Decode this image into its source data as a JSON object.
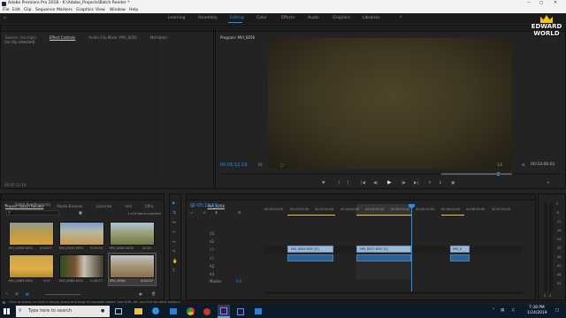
{
  "title": "Adobe Premiere Pro 2018 - K:\\Adobe_Projects\\Batch Render *",
  "menu": [
    "File",
    "Edit",
    "Clip",
    "Sequence",
    "Markers",
    "Graphics",
    "View",
    "Window",
    "Help"
  ],
  "workspaces": [
    "Learning",
    "Assembly",
    "Editing",
    "Color",
    "Effects",
    "Audio",
    "Graphics",
    "Libraries"
  ],
  "active_workspace": "Editing",
  "brand": {
    "line1": "EDWARD",
    "line2": "WORLD"
  },
  "source_panel": {
    "tabs": [
      "Source: (no clips)",
      "Effect Controls",
      "Audio Clip Mixer: MVI_6056",
      "Metadata"
    ],
    "active_tab": "Effect Controls",
    "body_text": "(no clip selected)",
    "footer_time": "00:05:12:19"
  },
  "program": {
    "tab": "Program: MVI_6056",
    "timecode": "00:05:12:19",
    "fit": "Fit",
    "quality": "1/2",
    "duration": "00:10:06:01"
  },
  "project": {
    "tabs": [
      "Project: Batch Render",
      "Media Browser",
      "Libraries",
      "Info",
      "Effec"
    ],
    "active_tab": "Project: Batch Render",
    "file": "Batch Render.prproj",
    "count": "1 of 6 items selected",
    "thumbs": [
      {
        "name": "MVI_6056.MOV",
        "dur": "4:04:01"
      },
      {
        "name": "MVI_6055.MOV",
        "dur": "5:01:00"
      },
      {
        "name": "MVI_6060.MOV",
        "dur": "10:01"
      },
      {
        "name": "MVI_6063.MOV",
        "dur": "4:07"
      },
      {
        "name": "MVI_6065.MOV",
        "dur": "2:28:27"
      },
      {
        "name": "MVI_6056",
        "dur": "4:02:07"
      }
    ]
  },
  "timeline": {
    "tab": "MVI_6056",
    "timecode": "00:05:12:19",
    "ruler": [
      "00:02:30:00",
      "00:03:00:00",
      "00:03:30:00",
      "00:04:00:00",
      "00:04:30:00",
      "00:05:00:00",
      "00:05:30:00",
      "00:06:00:00",
      "00:06:30:00",
      "00:07:00:00",
      "00:07:30:00"
    ],
    "video_tracks": [
      "V3",
      "V2",
      "V1"
    ],
    "audio_tracks": [
      "A1",
      "A2",
      "A3"
    ],
    "master": "Master",
    "master_val": "0.0",
    "clips": [
      "MVI_6056.MOV [V]",
      "MVI_6057.MOV [V]",
      "MVI_6"
    ],
    "meter_labels": [
      "0",
      "-6",
      "-12",
      "-18",
      "-24",
      "-30",
      "-36",
      "-42",
      "-48",
      "-54"
    ],
    "meter_foot": [
      "S",
      "S"
    ]
  },
  "status": "Click to select, or click in empty space and drag to marquee select. Use Shift, Alt, and Ctrl for other options.",
  "taskbar": {
    "search": "Type here to search",
    "time": "7:38 PM",
    "date": "1/24/2019"
  }
}
